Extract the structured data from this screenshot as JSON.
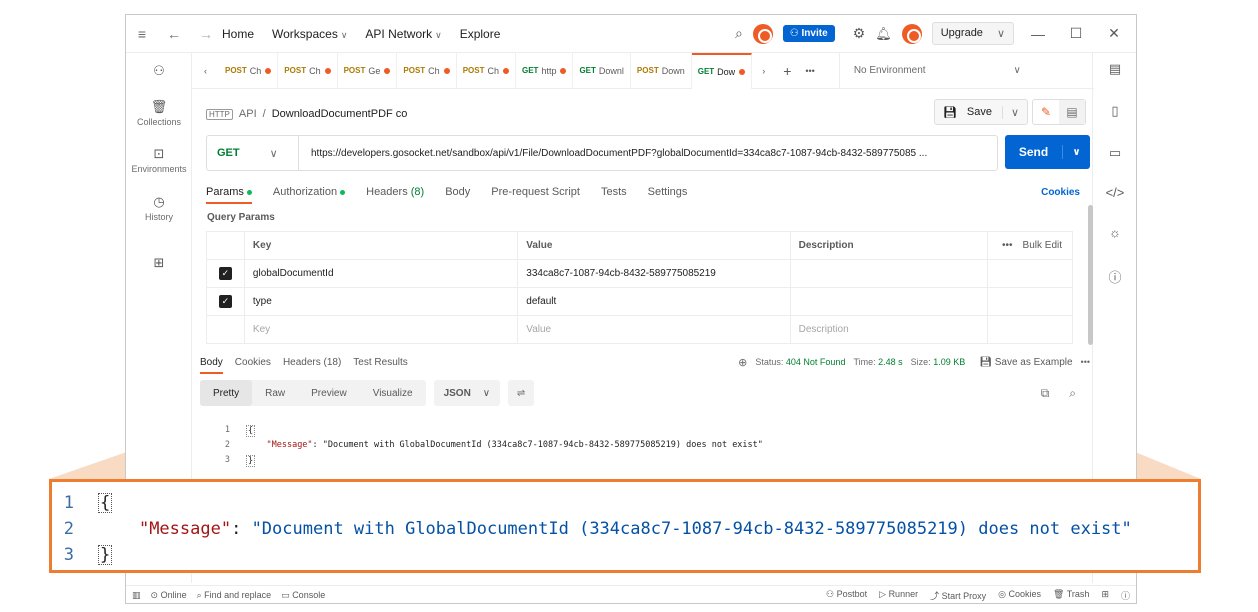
{
  "titlebar": {
    "home": "Home",
    "workspaces": "Workspaces",
    "api_network": "API Network",
    "explore": "Explore",
    "invite": "Invite",
    "upgrade": "Upgrade"
  },
  "sidebar": {
    "items": [
      {
        "label": "Collections"
      },
      {
        "label": "Environments"
      },
      {
        "label": "History"
      }
    ]
  },
  "tabs": [
    {
      "method": "POST",
      "name": "Ch"
    },
    {
      "method": "POST",
      "name": "Ch"
    },
    {
      "method": "POST",
      "name": "Ge"
    },
    {
      "method": "POST",
      "name": "Ch"
    },
    {
      "method": "POST",
      "name": "Ch"
    },
    {
      "method": "GET",
      "name": "http"
    },
    {
      "method": "GET",
      "name": "Downl"
    },
    {
      "method": "POST",
      "name": "Down"
    },
    {
      "method": "GET",
      "name": "Dow"
    }
  ],
  "environment": "No Environment",
  "request": {
    "breadcrumb_parent": "API",
    "breadcrumb_sep": "/",
    "name": "DownloadDocumentPDF co",
    "save_label": "Save",
    "method": "GET",
    "url": "https://developers.gosocket.net/sandbox/api/v1/File/DownloadDocumentPDF?globalDocumentId=334ca8c7-1087-94cb-8432-589775085 ...",
    "send_label": "Send",
    "tabs": {
      "params": "Params",
      "authorization": "Authorization",
      "headers": "Headers",
      "headers_count": "(8)",
      "body": "Body",
      "prerequest": "Pre-request Script",
      "tests": "Tests",
      "settings": "Settings"
    },
    "cookies_label": "Cookies",
    "query_params_label": "Query Params"
  },
  "params_table": {
    "headers": {
      "key": "Key",
      "value": "Value",
      "description": "Description",
      "bulk_edit": "Bulk Edit"
    },
    "rows": [
      {
        "key": "globalDocumentId",
        "value": "334ca8c7-1087-94cb-8432-589775085219",
        "description": ""
      },
      {
        "key": "type",
        "value": "default",
        "description": ""
      }
    ],
    "placeholder": {
      "key": "Key",
      "value": "Value",
      "description": "Description"
    }
  },
  "response": {
    "tabs": {
      "body": "Body",
      "cookies": "Cookies",
      "headers": "Headers (18)",
      "test_results": "Test Results"
    },
    "status_label": "Status:",
    "status_value": "404 Not Found",
    "time_label": "Time:",
    "time_value": "2.48 s",
    "size_label": "Size:",
    "size_value": "1.09 KB",
    "save_example": "Save as Example",
    "views": [
      "Pretty",
      "Raw",
      "Preview",
      "Visualize"
    ],
    "format": "JSON",
    "lines": [
      {
        "n": "1",
        "open": "{"
      },
      {
        "n": "2",
        "key": "\"Message\"",
        "sep": ": ",
        "val": "\"Document with GlobalDocumentId (334ca8c7-1087-94cb-8432-589775085219) does not exist\""
      },
      {
        "n": "3",
        "close": "}"
      }
    ]
  },
  "statusbar": {
    "online": "Online",
    "find_replace": "Find and replace",
    "console": "Console",
    "postbot": "Postbot",
    "runner": "Runner",
    "start_proxy": "Start Proxy",
    "cookies": "Cookies",
    "trash": "Trash"
  },
  "colors": {
    "accent": "#ef5b25",
    "primary": "#0265d2",
    "callout": "#ed7d31",
    "callout_fill": "#f8d3b8"
  }
}
